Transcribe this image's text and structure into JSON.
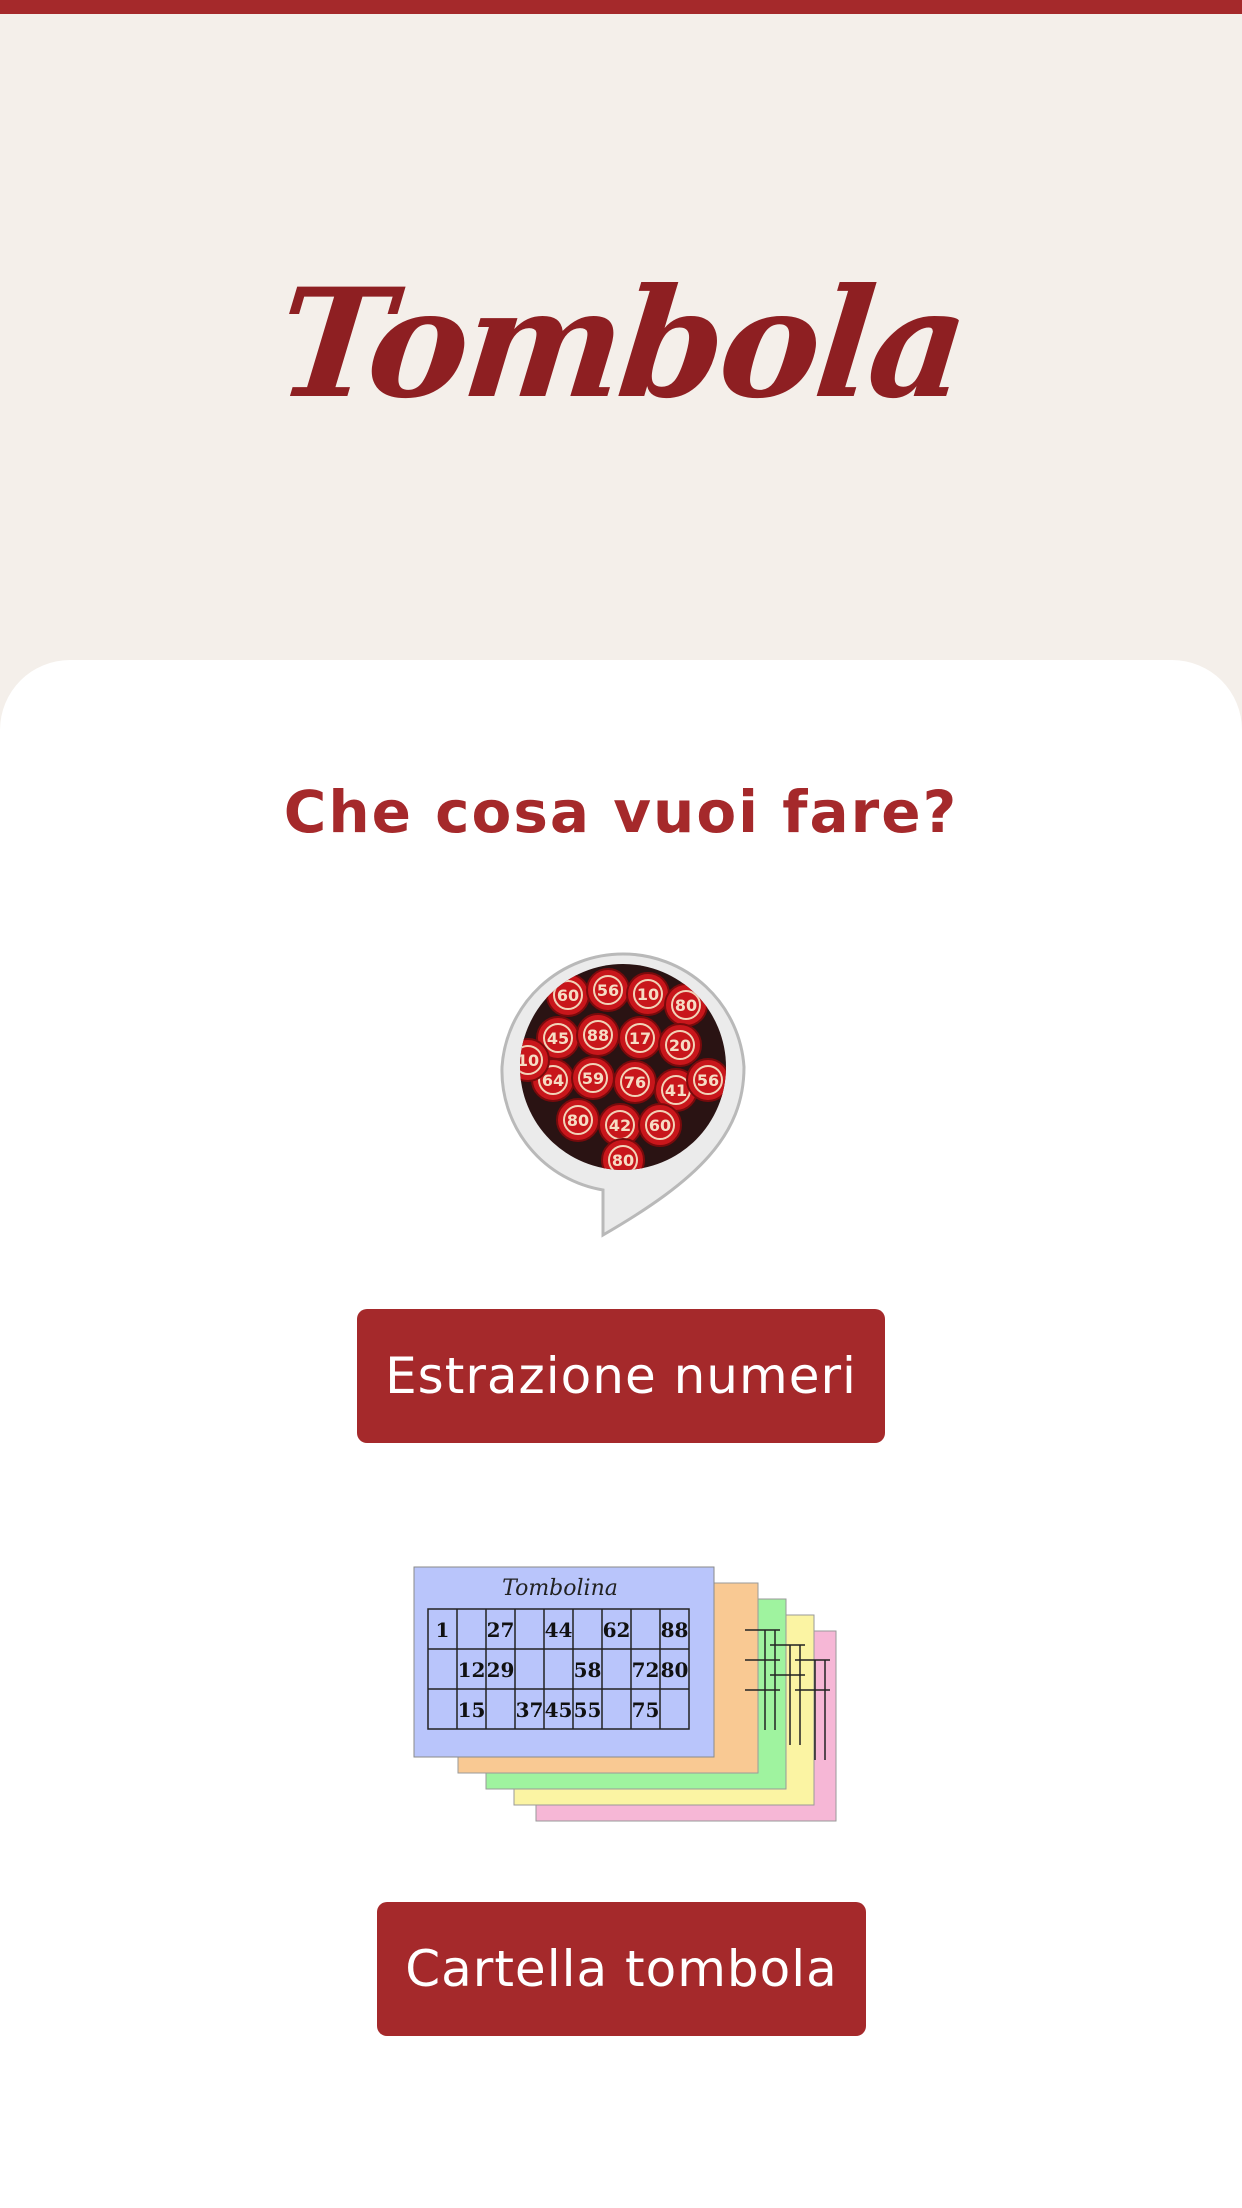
{
  "app": {
    "title": "Tombola"
  },
  "main": {
    "question": "Che cosa vuoi fare?",
    "actions": [
      {
        "label": "Estrazione numeri",
        "icon": "tombola-numbers-bubble-icon"
      },
      {
        "label": "Cartella tombola",
        "icon": "tombola-cards-icon"
      }
    ]
  },
  "bubble_numbers": [
    "60",
    "56",
    "10",
    "80",
    "45",
    "88",
    "17",
    "20",
    "64",
    "59",
    "76",
    "41",
    "80",
    "42"
  ],
  "tombolina": {
    "title": "Tombolina",
    "rows": [
      [
        "1",
        "",
        "27",
        "",
        "44",
        "",
        "62",
        "",
        "88"
      ],
      [
        "",
        "12",
        "29",
        "",
        "",
        "58",
        "",
        "72",
        "80"
      ],
      [
        "",
        "15",
        "",
        "37",
        "45",
        "55",
        "",
        "75",
        ""
      ]
    ]
  },
  "colors": {
    "accent": "#a5292b",
    "header_bg": "#f4efea",
    "card_bg": "#ffffff"
  }
}
